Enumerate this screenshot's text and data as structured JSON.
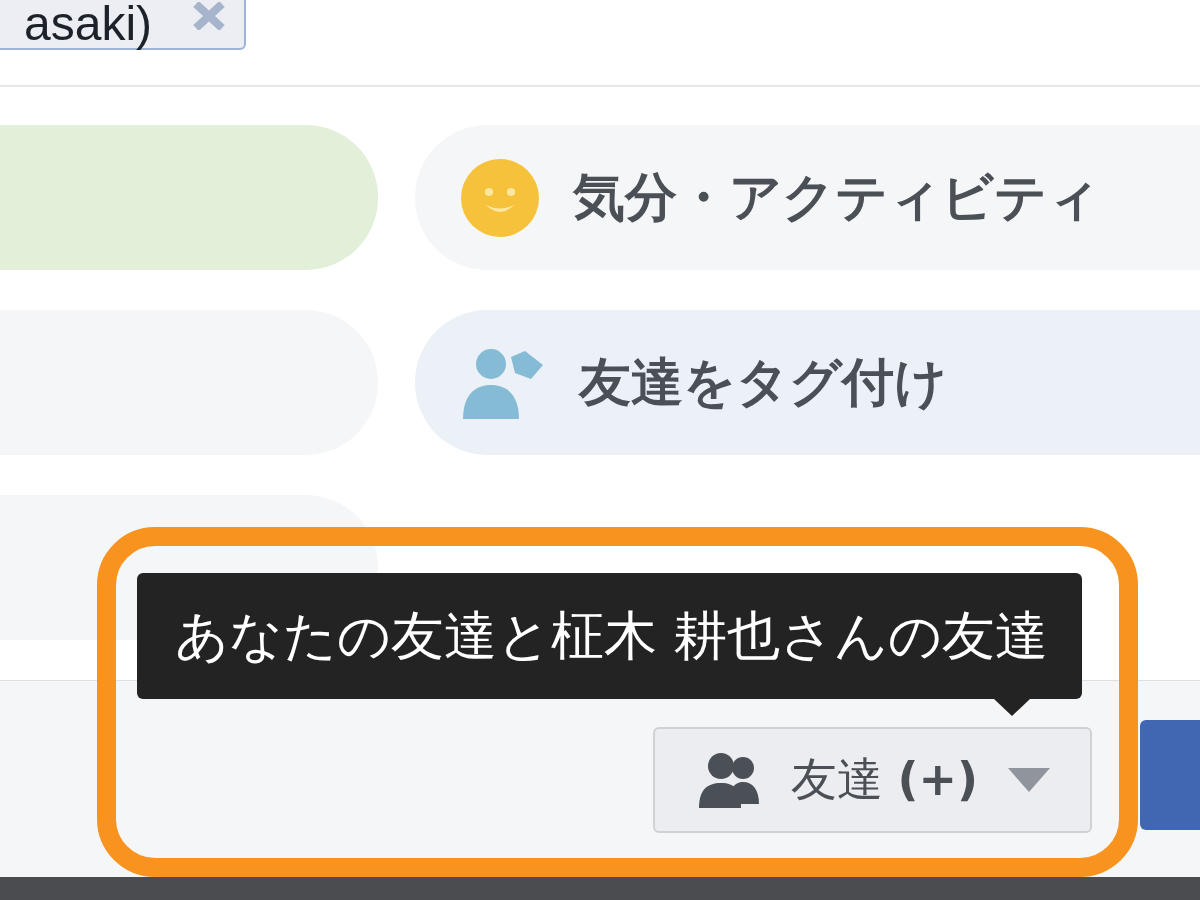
{
  "tag_chip": {
    "label": "asaki)"
  },
  "left_options": [
    {
      "color": "#e2efd9"
    },
    {
      "color": "#f5f6f7"
    },
    {
      "color": "#f5f6f7"
    }
  ],
  "options": [
    {
      "kind": "mood",
      "label": "気分・アクティビティ",
      "color": "#f5f6f7"
    },
    {
      "kind": "tag_friends",
      "label": "友達をタグ付け",
      "color": "#ecf0f7"
    }
  ],
  "tooltip": {
    "text": "あなたの友達と柾木 耕也さんの友達"
  },
  "audience_button": {
    "label": "友達 **(+)**"
  }
}
